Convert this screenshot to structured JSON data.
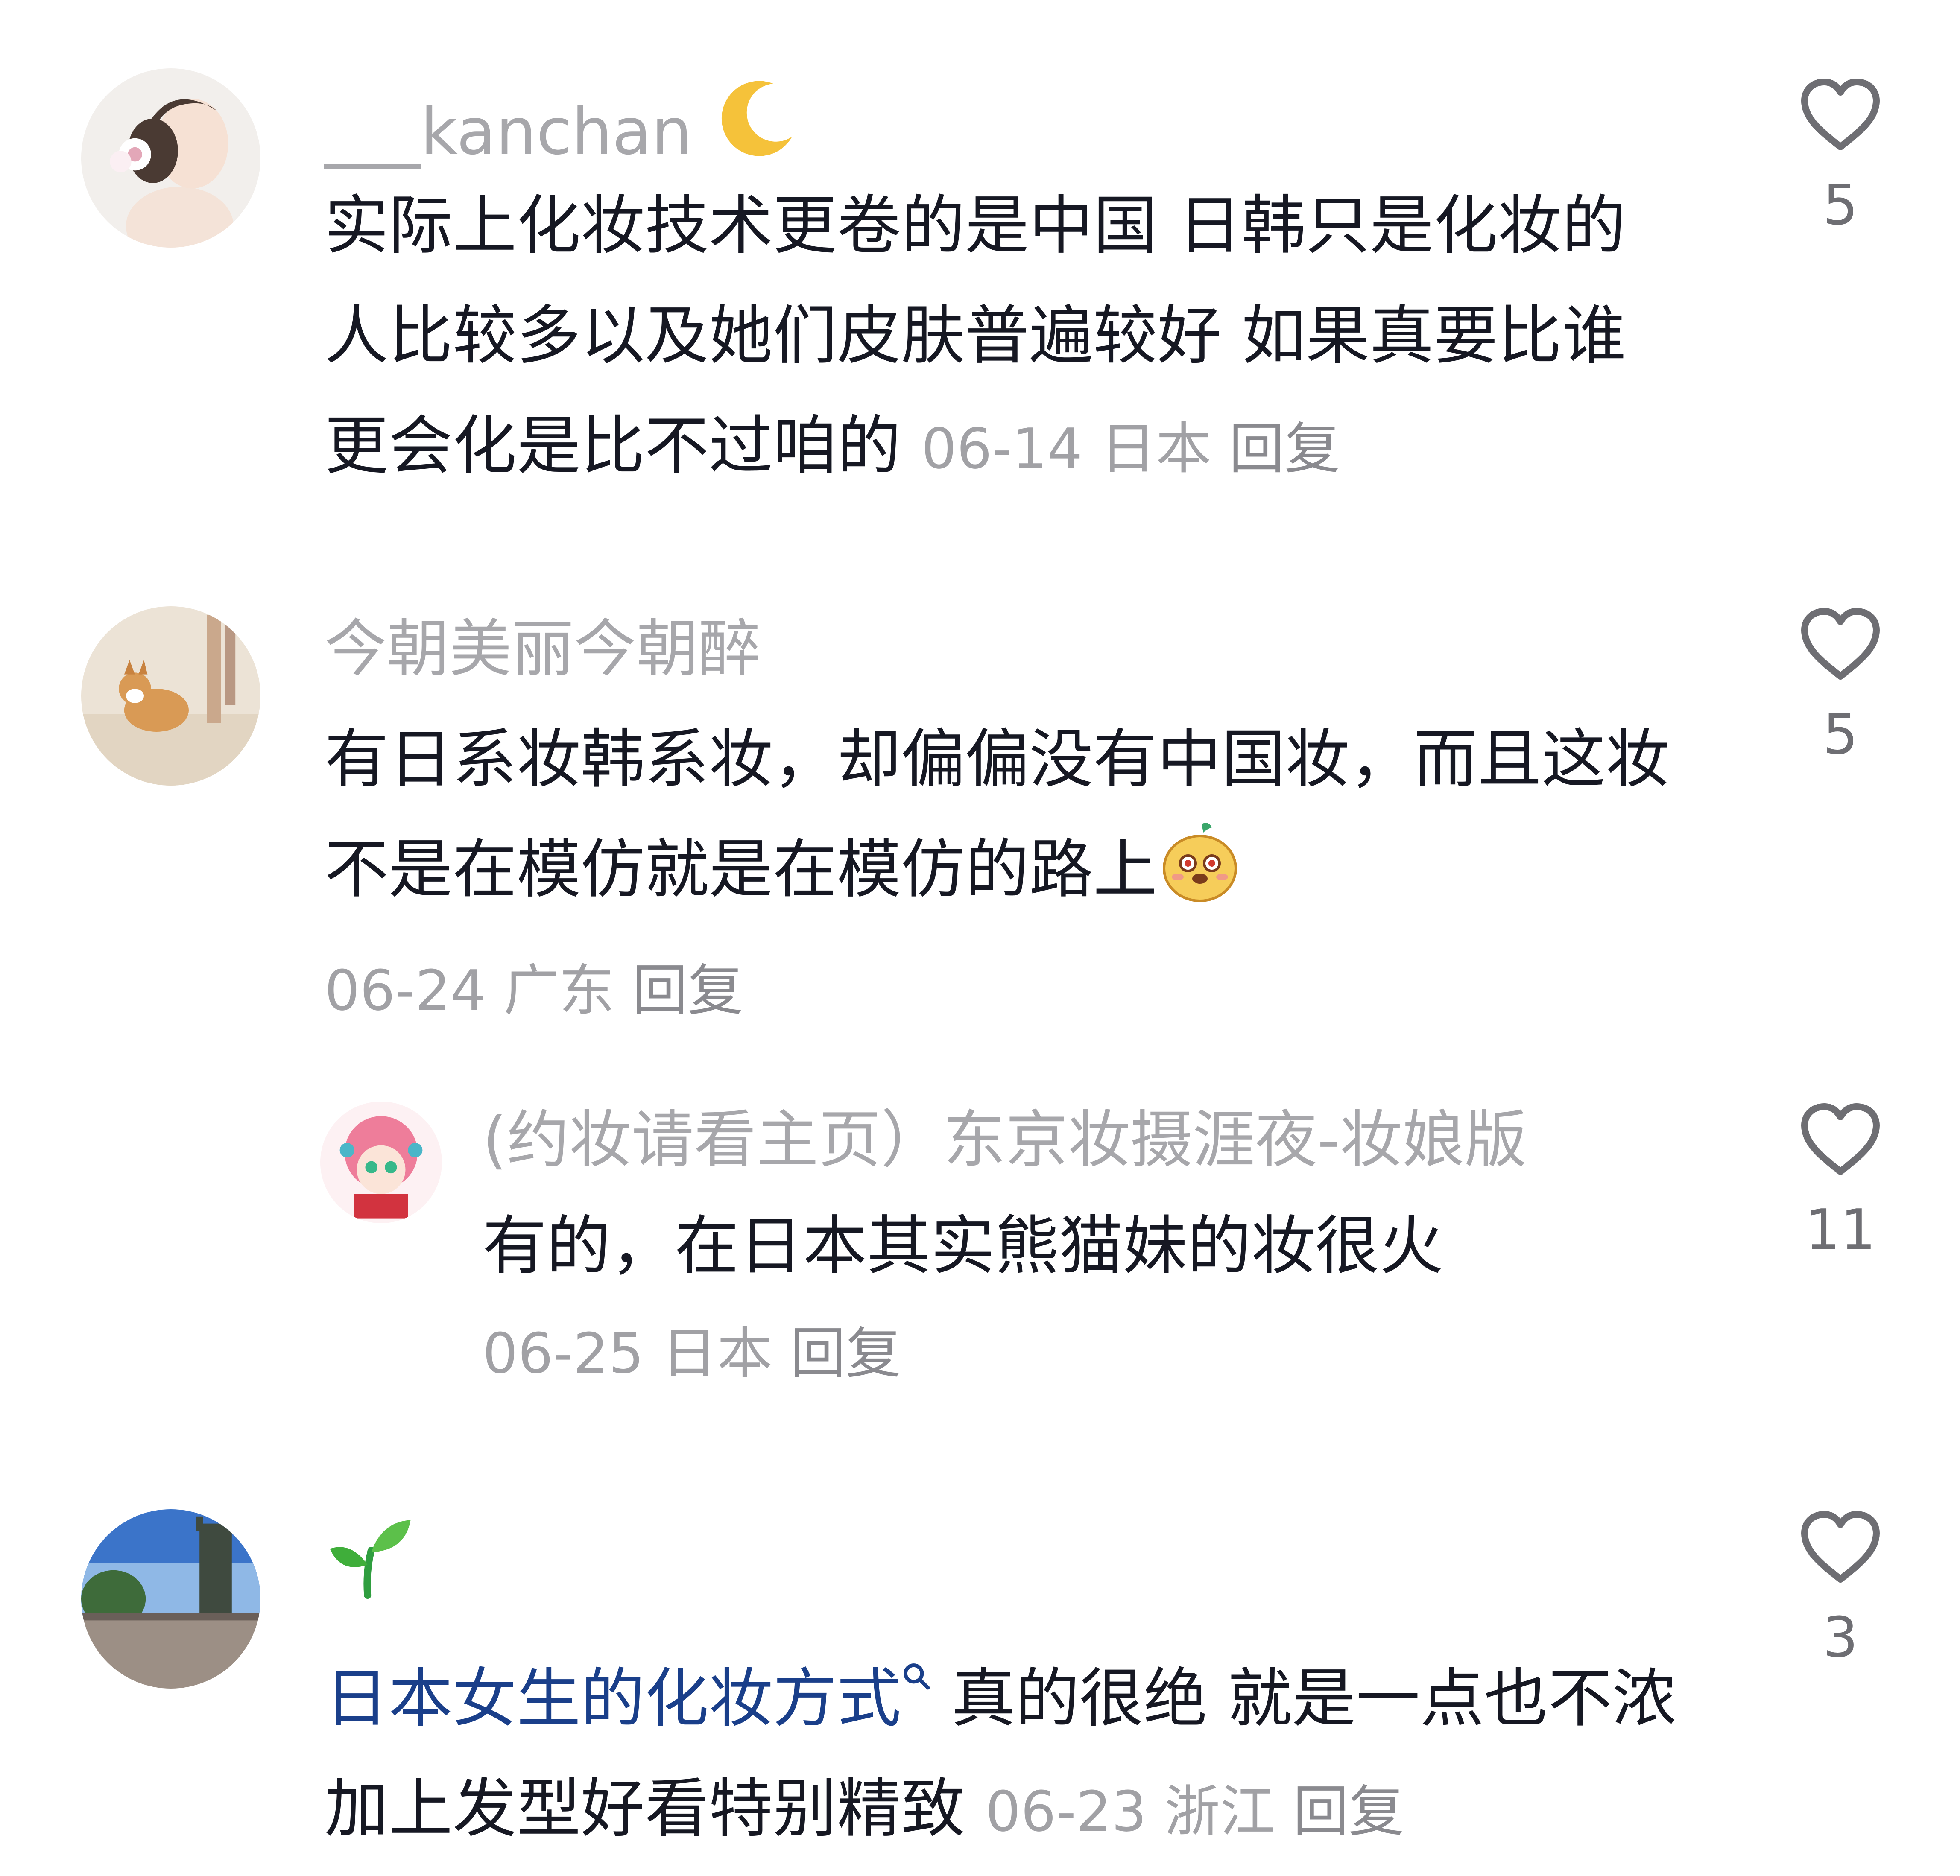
{
  "comments": [
    {
      "username": "___kanchan",
      "username_icon": "crescent-moon-icon",
      "text": "实际上化妆技术更卷的是中国 日韩只是化妆的人比较多以及她们皮肤普遍较好 如果真要比谁更会化是比不过咱的",
      "date": "06-14",
      "location": "日本",
      "reply_label": "回复",
      "likes": "5"
    },
    {
      "username": "今朝美丽今朝醉",
      "text": "有日系妆韩系妆，却偏偏没有中国妆，而且这妆不是在模仿就是在模仿的路上",
      "text_emoji": "blush-emoji-icon",
      "date": "06-24",
      "location": "广东",
      "reply_label": "回复",
      "likes": "5",
      "replies": [
        {
          "username": "(约妆请看主页）东京妆摄涯夜-妆娘版",
          "text": "有的，在日本其实熊猫妹的妆很火",
          "date": "06-25",
          "location": "日本",
          "reply_label": "回复",
          "likes": "11"
        }
      ]
    },
    {
      "username_icon": "seedling-icon",
      "link_text": "日本女生的化妆方式",
      "text": "真的很绝  就是一点也不浓 加上发型好看特别精致",
      "date": "06-23",
      "location": "浙江",
      "reply_label": "回复",
      "likes": "3"
    }
  ],
  "colors": {
    "username": "#a7a7ab",
    "body": "#161823",
    "meta": "#a1a1a5",
    "link": "#1a3f8a",
    "heart": "#6e6e73"
  }
}
